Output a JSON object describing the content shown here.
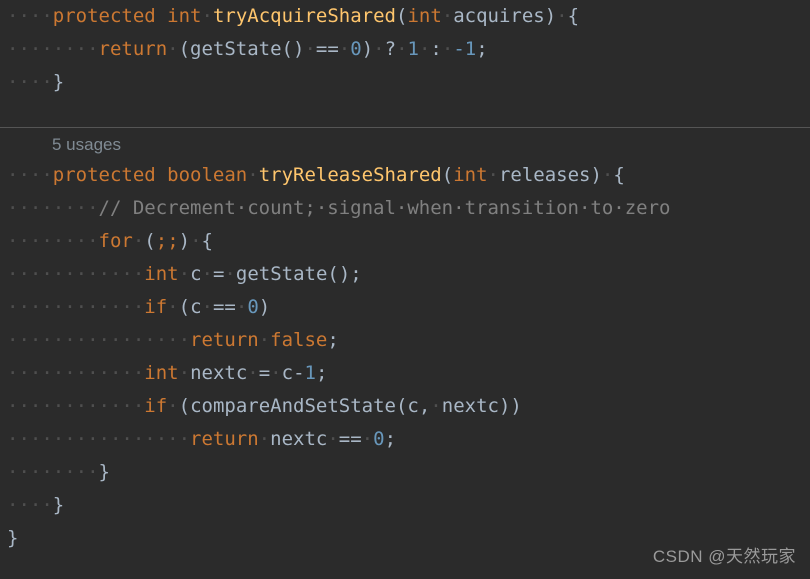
{
  "editor": {
    "theme_name": "darcula",
    "background_color": "#2b2b2b",
    "separator_color": "#555555",
    "colors": {
      "keyword": "#cc7832",
      "method_declaration": "#ffc66d",
      "identifier": "#a9b7c6",
      "number": "#6897bb",
      "comment": "#808080",
      "whitespace_dot": "#4f4f4f",
      "code_vision_hint": "#808b94",
      "watermark": "#9a9a9a"
    }
  },
  "code_vision": {
    "usages_label": "5 usages"
  },
  "top_region": {
    "lines": [
      {
        "indent_dots": "····",
        "tokens": [
          {
            "text": "protected",
            "type": "keyword"
          },
          {
            "text": " ",
            "type": "plain"
          },
          {
            "text": "int",
            "type": "keyword"
          },
          {
            "text": "·",
            "type": "whitespace"
          },
          {
            "text": "tryAcquireShared",
            "type": "method_declaration"
          },
          {
            "text": "(",
            "type": "identifier"
          },
          {
            "text": "int",
            "type": "keyword"
          },
          {
            "text": "·",
            "type": "whitespace"
          },
          {
            "text": "acquires)",
            "type": "identifier"
          },
          {
            "text": "·",
            "type": "whitespace"
          },
          {
            "text": "{",
            "type": "identifier"
          }
        ]
      },
      {
        "indent_dots": "········",
        "tokens": [
          {
            "text": "return",
            "type": "keyword"
          },
          {
            "text": "·",
            "type": "whitespace"
          },
          {
            "text": "(getState()",
            "type": "identifier"
          },
          {
            "text": "·",
            "type": "whitespace"
          },
          {
            "text": "==",
            "type": "identifier"
          },
          {
            "text": "·",
            "type": "whitespace"
          },
          {
            "text": "0",
            "type": "number"
          },
          {
            "text": ")",
            "type": "identifier"
          },
          {
            "text": "·",
            "type": "whitespace"
          },
          {
            "text": "?",
            "type": "identifier"
          },
          {
            "text": "·",
            "type": "whitespace"
          },
          {
            "text": "1",
            "type": "number"
          },
          {
            "text": "·",
            "type": "whitespace"
          },
          {
            "text": ":",
            "type": "identifier"
          },
          {
            "text": "·",
            "type": "whitespace"
          },
          {
            "text": "-1",
            "type": "number"
          },
          {
            "text": ";",
            "type": "identifier"
          }
        ]
      },
      {
        "indent_dots": "····",
        "tokens": [
          {
            "text": "}",
            "type": "identifier"
          }
        ]
      }
    ]
  },
  "bottom_region": {
    "lines": [
      {
        "indent_dots": "····",
        "tokens": [
          {
            "text": "protected",
            "type": "keyword"
          },
          {
            "text": " ",
            "type": "plain"
          },
          {
            "text": "boolean",
            "type": "keyword"
          },
          {
            "text": "·",
            "type": "whitespace"
          },
          {
            "text": "tryReleaseShared",
            "type": "method_declaration"
          },
          {
            "text": "(",
            "type": "identifier"
          },
          {
            "text": "int",
            "type": "keyword"
          },
          {
            "text": "·",
            "type": "whitespace"
          },
          {
            "text": "releases)",
            "type": "identifier"
          },
          {
            "text": "·",
            "type": "whitespace"
          },
          {
            "text": "{",
            "type": "identifier"
          }
        ]
      },
      {
        "indent_dots": "········",
        "tokens": [
          {
            "text": "// Decrement·count;·signal·when·transition·to·zero",
            "type": "comment"
          }
        ]
      },
      {
        "indent_dots": "········",
        "tokens": [
          {
            "text": "for",
            "type": "keyword"
          },
          {
            "text": "·",
            "type": "whitespace"
          },
          {
            "text": "(",
            "type": "identifier"
          },
          {
            "text": ";;",
            "type": "keyword"
          },
          {
            "text": ")",
            "type": "identifier"
          },
          {
            "text": "·",
            "type": "whitespace"
          },
          {
            "text": "{",
            "type": "identifier"
          }
        ]
      },
      {
        "indent_dots": "············",
        "tokens": [
          {
            "text": "int",
            "type": "keyword"
          },
          {
            "text": "·",
            "type": "whitespace"
          },
          {
            "text": "c",
            "type": "identifier"
          },
          {
            "text": "·",
            "type": "whitespace"
          },
          {
            "text": "=",
            "type": "identifier"
          },
          {
            "text": "·",
            "type": "whitespace"
          },
          {
            "text": "getState();",
            "type": "identifier"
          }
        ]
      },
      {
        "indent_dots": "············",
        "tokens": [
          {
            "text": "if",
            "type": "keyword"
          },
          {
            "text": "·",
            "type": "whitespace"
          },
          {
            "text": "(c",
            "type": "identifier"
          },
          {
            "text": "·",
            "type": "whitespace"
          },
          {
            "text": "==",
            "type": "identifier"
          },
          {
            "text": "·",
            "type": "whitespace"
          },
          {
            "text": "0",
            "type": "number"
          },
          {
            "text": ")",
            "type": "identifier"
          }
        ]
      },
      {
        "indent_dots": "················",
        "tokens": [
          {
            "text": "return",
            "type": "keyword"
          },
          {
            "text": "·",
            "type": "whitespace"
          },
          {
            "text": "false",
            "type": "keyword"
          },
          {
            "text": ";",
            "type": "identifier"
          }
        ]
      },
      {
        "indent_dots": "············",
        "tokens": [
          {
            "text": "int",
            "type": "keyword"
          },
          {
            "text": "·",
            "type": "whitespace"
          },
          {
            "text": "nextc",
            "type": "identifier"
          },
          {
            "text": "·",
            "type": "whitespace"
          },
          {
            "text": "=",
            "type": "identifier"
          },
          {
            "text": "·",
            "type": "whitespace"
          },
          {
            "text": "c-",
            "type": "identifier"
          },
          {
            "text": "1",
            "type": "number"
          },
          {
            "text": ";",
            "type": "identifier"
          }
        ]
      },
      {
        "indent_dots": "············",
        "tokens": [
          {
            "text": "if",
            "type": "keyword"
          },
          {
            "text": "·",
            "type": "whitespace"
          },
          {
            "text": "(compareAndSetState(c,",
            "type": "identifier"
          },
          {
            "text": "·",
            "type": "whitespace"
          },
          {
            "text": "nextc))",
            "type": "identifier"
          }
        ]
      },
      {
        "indent_dots": "················",
        "tokens": [
          {
            "text": "return",
            "type": "keyword"
          },
          {
            "text": "·",
            "type": "whitespace"
          },
          {
            "text": "nextc",
            "type": "identifier"
          },
          {
            "text": "·",
            "type": "whitespace"
          },
          {
            "text": "==",
            "type": "identifier"
          },
          {
            "text": "·",
            "type": "whitespace"
          },
          {
            "text": "0",
            "type": "number"
          },
          {
            "text": ";",
            "type": "identifier"
          }
        ]
      },
      {
        "indent_dots": "········",
        "tokens": [
          {
            "text": "}",
            "type": "identifier"
          }
        ]
      },
      {
        "indent_dots": "····",
        "tokens": [
          {
            "text": "}",
            "type": "identifier"
          }
        ]
      },
      {
        "indent_dots": "",
        "tokens": [
          {
            "text": "}",
            "type": "identifier"
          }
        ]
      }
    ]
  },
  "watermark": {
    "text": "CSDN @天然玩家"
  }
}
